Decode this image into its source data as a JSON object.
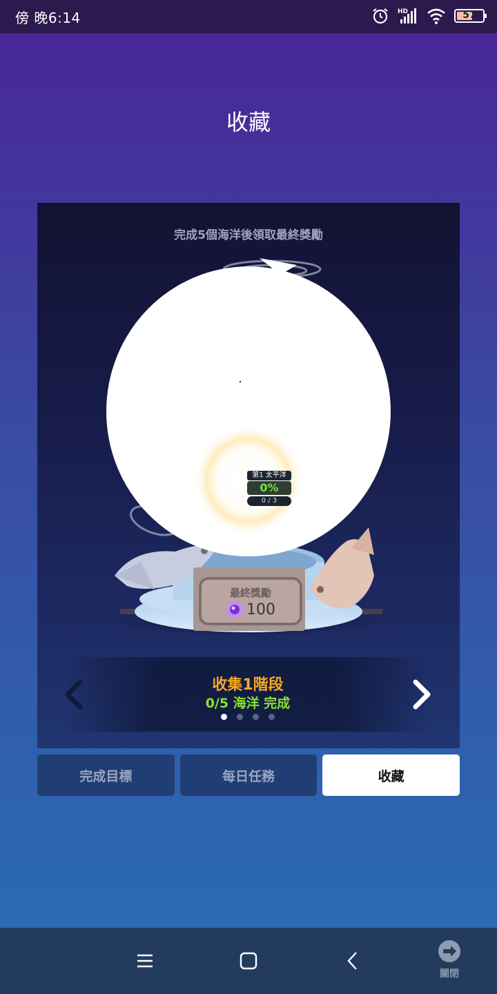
{
  "status_bar": {
    "time": "傍 晚6:14",
    "battery_level": "57",
    "icons": [
      "alarm-icon",
      "hd-signal-icon",
      "wifi-icon",
      "battery-icon"
    ]
  },
  "page": {
    "title": "收藏"
  },
  "card": {
    "instruction": "完成5個海洋後領取最終獎勵",
    "ocean_badge": {
      "name": "第1 太平洋",
      "percent": "0%",
      "count": "0 / 3"
    },
    "reward": {
      "label": "最終獎勵",
      "amount": "100",
      "icon": "purple-gem-icon"
    },
    "stage": {
      "title": "收集1階段",
      "progress": "0/5 海洋 完成",
      "page_count": 4,
      "active_page": 1
    }
  },
  "tabs": [
    {
      "label": "完成目標",
      "active": false
    },
    {
      "label": "每日任務",
      "active": false
    },
    {
      "label": "收藏",
      "active": true
    }
  ],
  "nav_bar": {
    "close_label": "關閉"
  },
  "colors": {
    "stage_title": "#f5a623",
    "stage_progress": "#8ae02d",
    "badge_percent": "#7be03a"
  }
}
